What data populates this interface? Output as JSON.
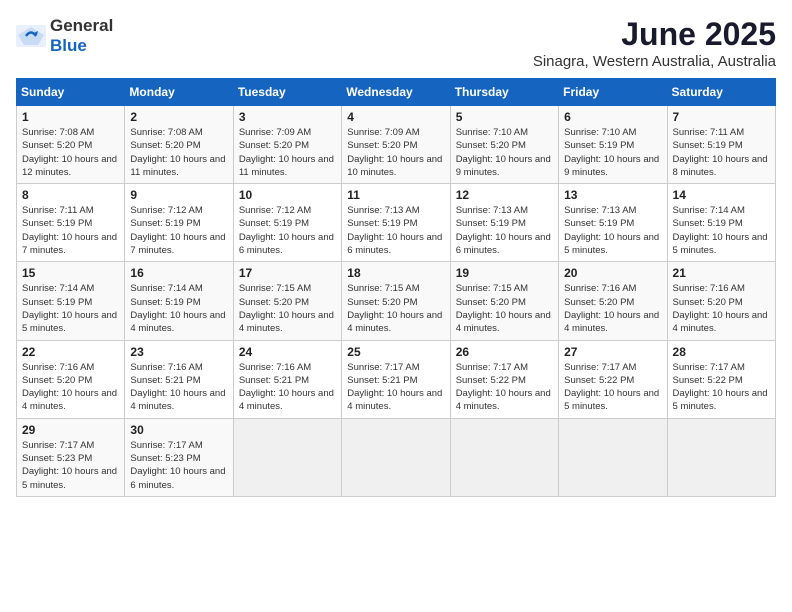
{
  "header": {
    "logo_general": "General",
    "logo_blue": "Blue",
    "title": "June 2025",
    "subtitle": "Sinagra, Western Australia, Australia"
  },
  "calendar": {
    "days_of_week": [
      "Sunday",
      "Monday",
      "Tuesday",
      "Wednesday",
      "Thursday",
      "Friday",
      "Saturday"
    ],
    "weeks": [
      [
        null,
        null,
        null,
        null,
        null,
        null,
        null
      ]
    ],
    "cells": [
      {
        "day": null
      },
      {
        "day": null
      },
      {
        "day": null
      },
      {
        "day": null
      },
      {
        "day": null
      },
      {
        "day": null
      },
      {
        "day": null
      },
      {
        "day": 1,
        "sunrise": "7:08 AM",
        "sunset": "5:20 PM",
        "daylight": "10 hours and 12 minutes."
      },
      {
        "day": 2,
        "sunrise": "7:08 AM",
        "sunset": "5:20 PM",
        "daylight": "10 hours and 11 minutes."
      },
      {
        "day": 3,
        "sunrise": "7:09 AM",
        "sunset": "5:20 PM",
        "daylight": "10 hours and 11 minutes."
      },
      {
        "day": 4,
        "sunrise": "7:09 AM",
        "sunset": "5:20 PM",
        "daylight": "10 hours and 10 minutes."
      },
      {
        "day": 5,
        "sunrise": "7:10 AM",
        "sunset": "5:20 PM",
        "daylight": "10 hours and 9 minutes."
      },
      {
        "day": 6,
        "sunrise": "7:10 AM",
        "sunset": "5:19 PM",
        "daylight": "10 hours and 9 minutes."
      },
      {
        "day": 7,
        "sunrise": "7:11 AM",
        "sunset": "5:19 PM",
        "daylight": "10 hours and 8 minutes."
      },
      {
        "day": 8,
        "sunrise": "7:11 AM",
        "sunset": "5:19 PM",
        "daylight": "10 hours and 7 minutes."
      },
      {
        "day": 9,
        "sunrise": "7:12 AM",
        "sunset": "5:19 PM",
        "daylight": "10 hours and 7 minutes."
      },
      {
        "day": 10,
        "sunrise": "7:12 AM",
        "sunset": "5:19 PM",
        "daylight": "10 hours and 6 minutes."
      },
      {
        "day": 11,
        "sunrise": "7:13 AM",
        "sunset": "5:19 PM",
        "daylight": "10 hours and 6 minutes."
      },
      {
        "day": 12,
        "sunrise": "7:13 AM",
        "sunset": "5:19 PM",
        "daylight": "10 hours and 6 minutes."
      },
      {
        "day": 13,
        "sunrise": "7:13 AM",
        "sunset": "5:19 PM",
        "daylight": "10 hours and 5 minutes."
      },
      {
        "day": 14,
        "sunrise": "7:14 AM",
        "sunset": "5:19 PM",
        "daylight": "10 hours and 5 minutes."
      },
      {
        "day": 15,
        "sunrise": "7:14 AM",
        "sunset": "5:19 PM",
        "daylight": "10 hours and 5 minutes."
      },
      {
        "day": 16,
        "sunrise": "7:14 AM",
        "sunset": "5:19 PM",
        "daylight": "10 hours and 4 minutes."
      },
      {
        "day": 17,
        "sunrise": "7:15 AM",
        "sunset": "5:20 PM",
        "daylight": "10 hours and 4 minutes."
      },
      {
        "day": 18,
        "sunrise": "7:15 AM",
        "sunset": "5:20 PM",
        "daylight": "10 hours and 4 minutes."
      },
      {
        "day": 19,
        "sunrise": "7:15 AM",
        "sunset": "5:20 PM",
        "daylight": "10 hours and 4 minutes."
      },
      {
        "day": 20,
        "sunrise": "7:16 AM",
        "sunset": "5:20 PM",
        "daylight": "10 hours and 4 minutes."
      },
      {
        "day": 21,
        "sunrise": "7:16 AM",
        "sunset": "5:20 PM",
        "daylight": "10 hours and 4 minutes."
      },
      {
        "day": 22,
        "sunrise": "7:16 AM",
        "sunset": "5:20 PM",
        "daylight": "10 hours and 4 minutes."
      },
      {
        "day": 23,
        "sunrise": "7:16 AM",
        "sunset": "5:21 PM",
        "daylight": "10 hours and 4 minutes."
      },
      {
        "day": 24,
        "sunrise": "7:16 AM",
        "sunset": "5:21 PM",
        "daylight": "10 hours and 4 minutes."
      },
      {
        "day": 25,
        "sunrise": "7:17 AM",
        "sunset": "5:21 PM",
        "daylight": "10 hours and 4 minutes."
      },
      {
        "day": 26,
        "sunrise": "7:17 AM",
        "sunset": "5:22 PM",
        "daylight": "10 hours and 4 minutes."
      },
      {
        "day": 27,
        "sunrise": "7:17 AM",
        "sunset": "5:22 PM",
        "daylight": "10 hours and 5 minutes."
      },
      {
        "day": 28,
        "sunrise": "7:17 AM",
        "sunset": "5:22 PM",
        "daylight": "10 hours and 5 minutes."
      },
      {
        "day": 29,
        "sunrise": "7:17 AM",
        "sunset": "5:23 PM",
        "daylight": "10 hours and 5 minutes."
      },
      {
        "day": 30,
        "sunrise": "7:17 AM",
        "sunset": "5:23 PM",
        "daylight": "10 hours and 6 minutes."
      },
      {
        "day": null
      },
      {
        "day": null
      },
      {
        "day": null
      },
      {
        "day": null
      },
      {
        "day": null
      }
    ]
  }
}
